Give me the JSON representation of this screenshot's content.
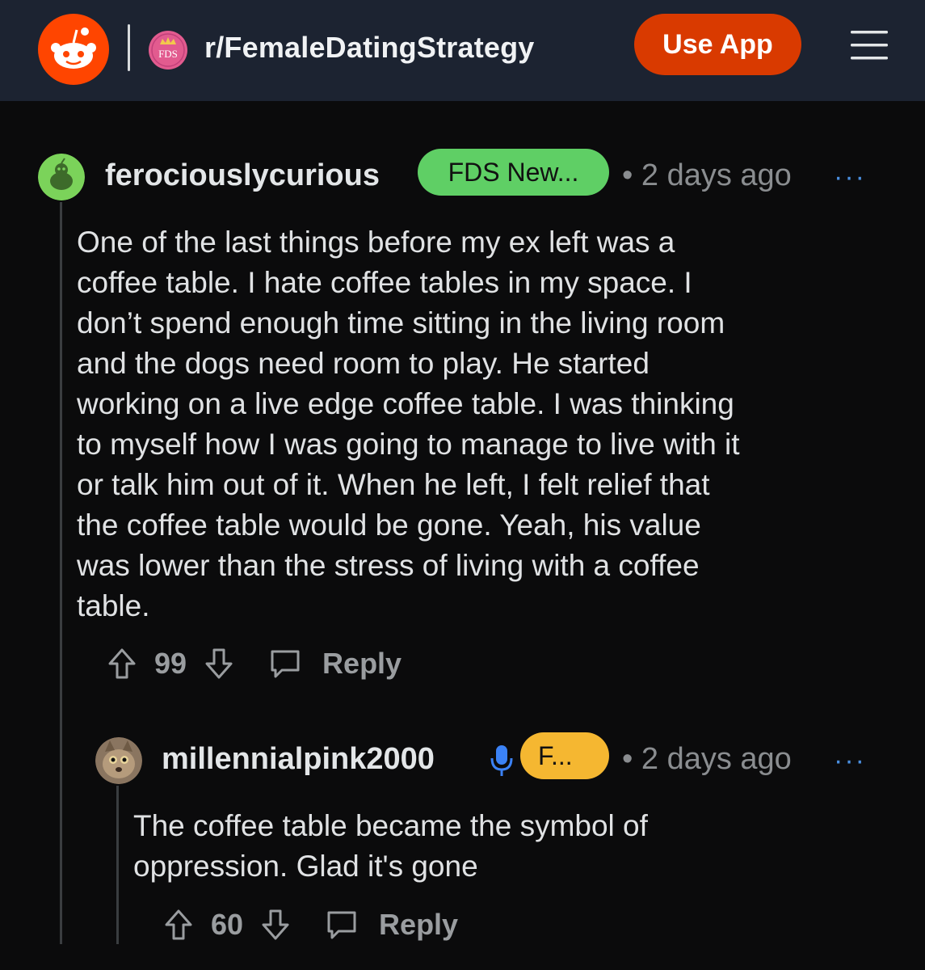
{
  "header": {
    "subreddit": "r/FemaleDatingStrategy",
    "subreddit_icon_text": "FDS",
    "use_app_label": "Use App"
  },
  "comments": [
    {
      "username": "ferociouslycurious",
      "flair": "FDS New...",
      "time": "2 days ago",
      "more": "···",
      "body": "One of the last things before my ex left was a\ncoffee table. I hate coffee tables in my space. I\ndon’t spend enough time sitting in the living room\nand the dogs need room to play. He started\nworking on a live edge coffee table. I was thinking\nto myself how I was going to manage to live with it\nor talk him out of it. When he left, I felt relief that\nthe coffee table would be gone. Yeah, his value\nwas lower than the stress of living with a coffee\ntable.",
      "votes": "99",
      "reply_label": "Reply"
    },
    {
      "username": "millennialpink2000",
      "flair": "F...",
      "time": "2 days ago",
      "more": "···",
      "body": "The coffee table became the symbol of\noppression. Glad it's gone",
      "votes": "60",
      "reply_label": "Reply"
    }
  ],
  "colors": {
    "header_bg": "#1c2331",
    "use_app_bg": "#d93a00",
    "flair_green": "#5fcf65",
    "flair_orange": "#f5b731",
    "body_bg": "#0b0b0c"
  }
}
